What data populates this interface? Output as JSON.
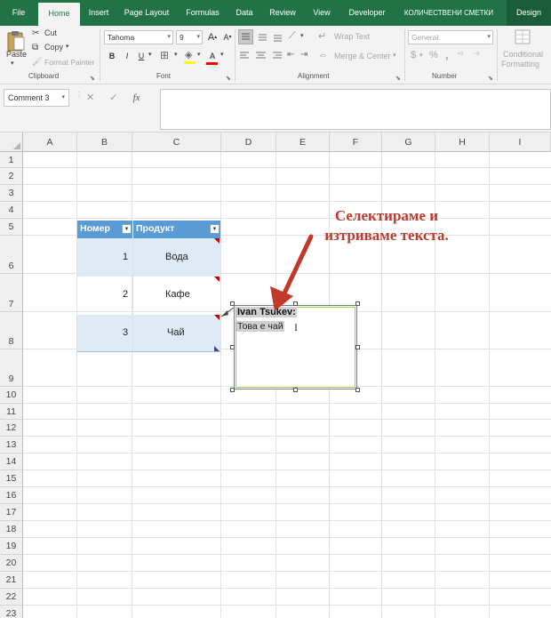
{
  "ribbon_tabs": [
    "File",
    "Home",
    "Insert",
    "Page Layout",
    "Formulas",
    "Data",
    "Review",
    "View",
    "Developer",
    "КОЛИЧЕСТВЕНИ СМЕТКИ",
    "Design"
  ],
  "ribbon": {
    "clipboard": {
      "paste": "Paste",
      "cut": "Cut",
      "copy": "Copy",
      "format_painter": "Format Painter",
      "label": "Clipboard"
    },
    "font": {
      "name": "Tahoma",
      "size": "9",
      "grow": "A",
      "shrink": "A",
      "bold": "B",
      "italic": "I",
      "underline": "U",
      "font_color": "A",
      "label": "Font"
    },
    "alignment": {
      "wrap_text": "Wrap Text",
      "merge_center": "Merge & Center",
      "label": "Alignment"
    },
    "number": {
      "format": "General",
      "currency": "$",
      "percent": "%",
      "comma": ",",
      "label": "Number"
    },
    "styles": {
      "conditional_formatting_1": "Conditional",
      "conditional_formatting_2": "Formatting"
    }
  },
  "formula_bar": {
    "name_box": "Comment 3",
    "cancel": "✕",
    "enter": "✓",
    "fx": "fx",
    "value": ""
  },
  "columns": [
    "A",
    "B",
    "C",
    "D",
    "E",
    "F",
    "G",
    "H",
    "I"
  ],
  "rows": [
    "1",
    "2",
    "3",
    "4",
    "5",
    "6",
    "7",
    "8",
    "9",
    "10",
    "11",
    "12",
    "13",
    "14",
    "15",
    "16",
    "17",
    "18",
    "19",
    "20",
    "21",
    "22",
    "23"
  ],
  "table": {
    "headers": [
      "Номер",
      "Продукт"
    ],
    "rows": [
      {
        "number": "1",
        "product": "Вода"
      },
      {
        "number": "2",
        "product": "Кафе"
      },
      {
        "number": "3",
        "product": "Чай"
      }
    ]
  },
  "comment": {
    "author": "Ivan Tsukev:",
    "text": "Това е чай"
  },
  "annotation": {
    "line1": "Селектираме и",
    "line2": "изтриваме текста."
  },
  "colors": {
    "excel_green": "#217346",
    "table_header": "#5b9bd5",
    "table_band": "#ddebf7",
    "annotation_red": "#c0392b",
    "comment_border": "#8fd14f"
  }
}
